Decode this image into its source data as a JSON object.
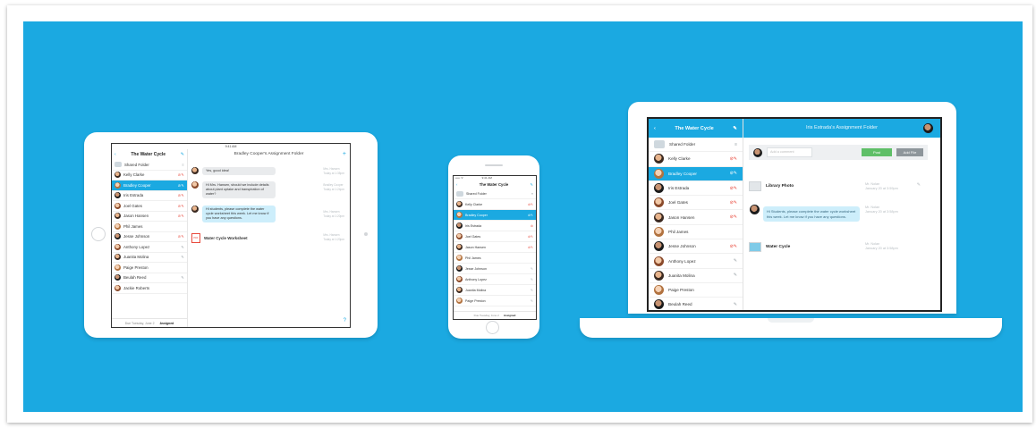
{
  "colors": {
    "background": "#1ba9e1",
    "accent": "#1ba9e1",
    "post_button": "#5fbf68",
    "alert": "#e8493c"
  },
  "ipad": {
    "status_time": "9:41 AM",
    "folder_title": "The Water Cycle",
    "back": "‹",
    "edit_icon": "pencil-icon",
    "list": [
      {
        "name": "Shared Folder",
        "status": "≡",
        "kind": "folder"
      },
      {
        "name": "Kelly Clarke",
        "status": "⊘✎"
      },
      {
        "name": "Bradley Cooper",
        "status": "⊘✎",
        "selected": true
      },
      {
        "name": "Iris Estrada",
        "status": "⊘✎"
      },
      {
        "name": "Joel Gates",
        "status": "⊘✎"
      },
      {
        "name": "Jason Hansen",
        "status": "⊘✎"
      },
      {
        "name": "Phil James",
        "status": ""
      },
      {
        "name": "Jesse Johnson",
        "status": "⊘✎"
      },
      {
        "name": "Anthony Lopez",
        "status": "✎"
      },
      {
        "name": "Juanita Molina",
        "status": "✎"
      },
      {
        "name": "Paige Preston",
        "status": ""
      },
      {
        "name": "Beulah Reed",
        "status": "✎"
      },
      {
        "name": "Jackie Roberts",
        "status": ""
      }
    ],
    "footer_due": "Due Tuesday, June 2",
    "footer_status": "Assigned",
    "folder_heading": "Bradley Cooper's Assignment Folder",
    "messages": [
      {
        "text": "Yes, good idea!",
        "meta1": "Mrs. Hansen",
        "meta2": "Today at 1:35pm"
      },
      {
        "text": "Hi Mrs. Hansen, should we include details about plant uptake and transpiration of water?",
        "meta1": "Bradley Cooper",
        "meta2": "Today at 1:24pm"
      },
      {
        "text": "Hi students, please complete the water cycle worksheet this week. Let me know if you have any questions.",
        "meta1": "Mrs. Hansen",
        "meta2": "Today at 1:20pm"
      }
    ],
    "worksheet": {
      "title": "Water Cycle Worksheet",
      "meta1": "Mrs. Hansen",
      "meta2": "Today at 1:20pm"
    }
  },
  "iphone": {
    "status_left": "••••• ᯤ",
    "status_time": "9:41 AM",
    "folder_title": "The Water Cycle",
    "list": [
      {
        "name": "Shared Folder",
        "status": "≡",
        "kind": "folder"
      },
      {
        "name": "Kelly Clarke",
        "status": "⊘✎"
      },
      {
        "name": "Bradley Cooper",
        "status": "⊘✎",
        "selected": true
      },
      {
        "name": "Iris Estrada",
        "status": "⊘"
      },
      {
        "name": "Joel Gates",
        "status": "⊘✎"
      },
      {
        "name": "Jason Hansen",
        "status": "⊘✎"
      },
      {
        "name": "Phil James",
        "status": ""
      },
      {
        "name": "Jesse Johnson",
        "status": "✎"
      },
      {
        "name": "Anthony Lopez",
        "status": "✎"
      },
      {
        "name": "Juanita Molina",
        "status": "✎"
      },
      {
        "name": "Paige Preston",
        "status": "✎"
      }
    ],
    "footer_due": "Due Tuesday, June 2",
    "footer_status": "Assigned"
  },
  "laptop": {
    "folder_title": "The Water Cycle",
    "back": "‹",
    "list": [
      {
        "name": "Shared Folder",
        "status": "≡",
        "kind": "folder"
      },
      {
        "name": "Kelly Clarke",
        "status": "⊘✎"
      },
      {
        "name": "Bradley Cooper",
        "status": "⊘✎",
        "selected": true
      },
      {
        "name": "Iris Estrada",
        "status": "⊘✎"
      },
      {
        "name": "Joel Gates",
        "status": "⊘✎"
      },
      {
        "name": "Jason Hansen",
        "status": "⊘✎"
      },
      {
        "name": "Phil James",
        "status": ""
      },
      {
        "name": "Jesse Johnson",
        "status": "⊘✎"
      },
      {
        "name": "Anthony Lopez",
        "status": "✎"
      },
      {
        "name": "Juanita Molina",
        "status": "✎"
      },
      {
        "name": "Paige Preston",
        "status": ""
      },
      {
        "name": "Beulah Reed",
        "status": "✎"
      }
    ],
    "folder_heading": "Iris Estrada's Assignment Folder",
    "compose_placeholder": "Add a comment",
    "post_label": "Post",
    "addfile_label": "Add File",
    "library_photo": {
      "title": "Library Photo",
      "meta1": "Mr. Nolan",
      "meta2": "January 20 at 3:59pm"
    },
    "message": {
      "text": "Hi Students, please complete the water cycle worksheet this week. Let me know if you have any questions.",
      "meta1": "Mr. Nolan",
      "meta2": "January 20 at 3:58pm"
    },
    "water_cycle": {
      "title": "Water Cycle",
      "meta1": "Mr. Nolan",
      "meta2": "January 20 at 3:58pm"
    }
  }
}
